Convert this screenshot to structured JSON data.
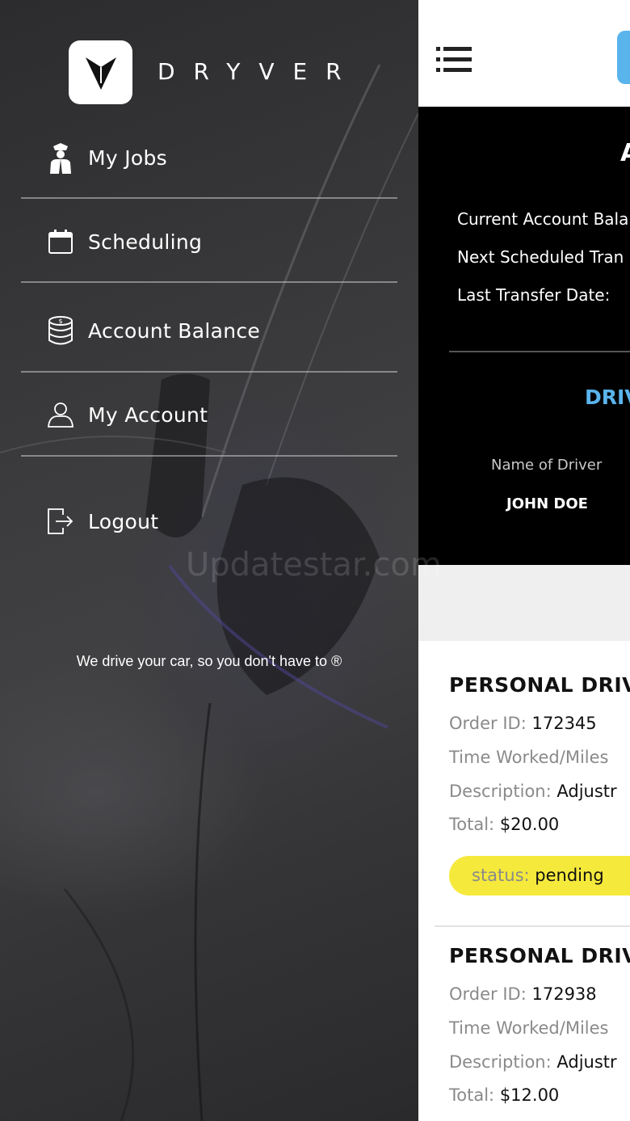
{
  "app": {
    "brand_name": "DRYVER",
    "accent_color": "#5ab4ec"
  },
  "drawer": {
    "items": [
      {
        "label": "My Jobs",
        "icon": "chauffeur-icon"
      },
      {
        "label": "Scheduling",
        "icon": "calendar-icon"
      },
      {
        "label": "Account Balance",
        "icon": "coins-icon"
      },
      {
        "label": "My Account",
        "icon": "user-icon"
      },
      {
        "label": "Logout",
        "icon": "logout-icon"
      }
    ],
    "tagline": "We drive your car, so you don't have to ®"
  },
  "balance": {
    "heading": "A",
    "current_label": "Current Account Bala",
    "next_label": "Next Scheduled Tran",
    "last_label": "Last Transfer Date:",
    "driver_section": "DRIV",
    "name_label": "Name of Driver",
    "name_value": "JOHN DOE"
  },
  "orders": [
    {
      "title": "PERSONAL DRIV",
      "order_id_label": "Order ID:",
      "order_id": "172345",
      "time_label": "Time Worked/Miles",
      "desc_label": "Description:",
      "desc": "Adjustr",
      "total_label": "Total:",
      "total": "$20.00",
      "status_label": "status:",
      "status": "pending"
    },
    {
      "title": "PERSONAL DRIV",
      "order_id_label": "Order ID:",
      "order_id": "172938",
      "time_label": "Time Worked/Miles",
      "desc_label": "Description:",
      "desc": "Adjustr",
      "total_label": "Total:",
      "total": "$12.00"
    }
  ],
  "status_color": "#f5e93c",
  "watermark": "Updatestar.com"
}
